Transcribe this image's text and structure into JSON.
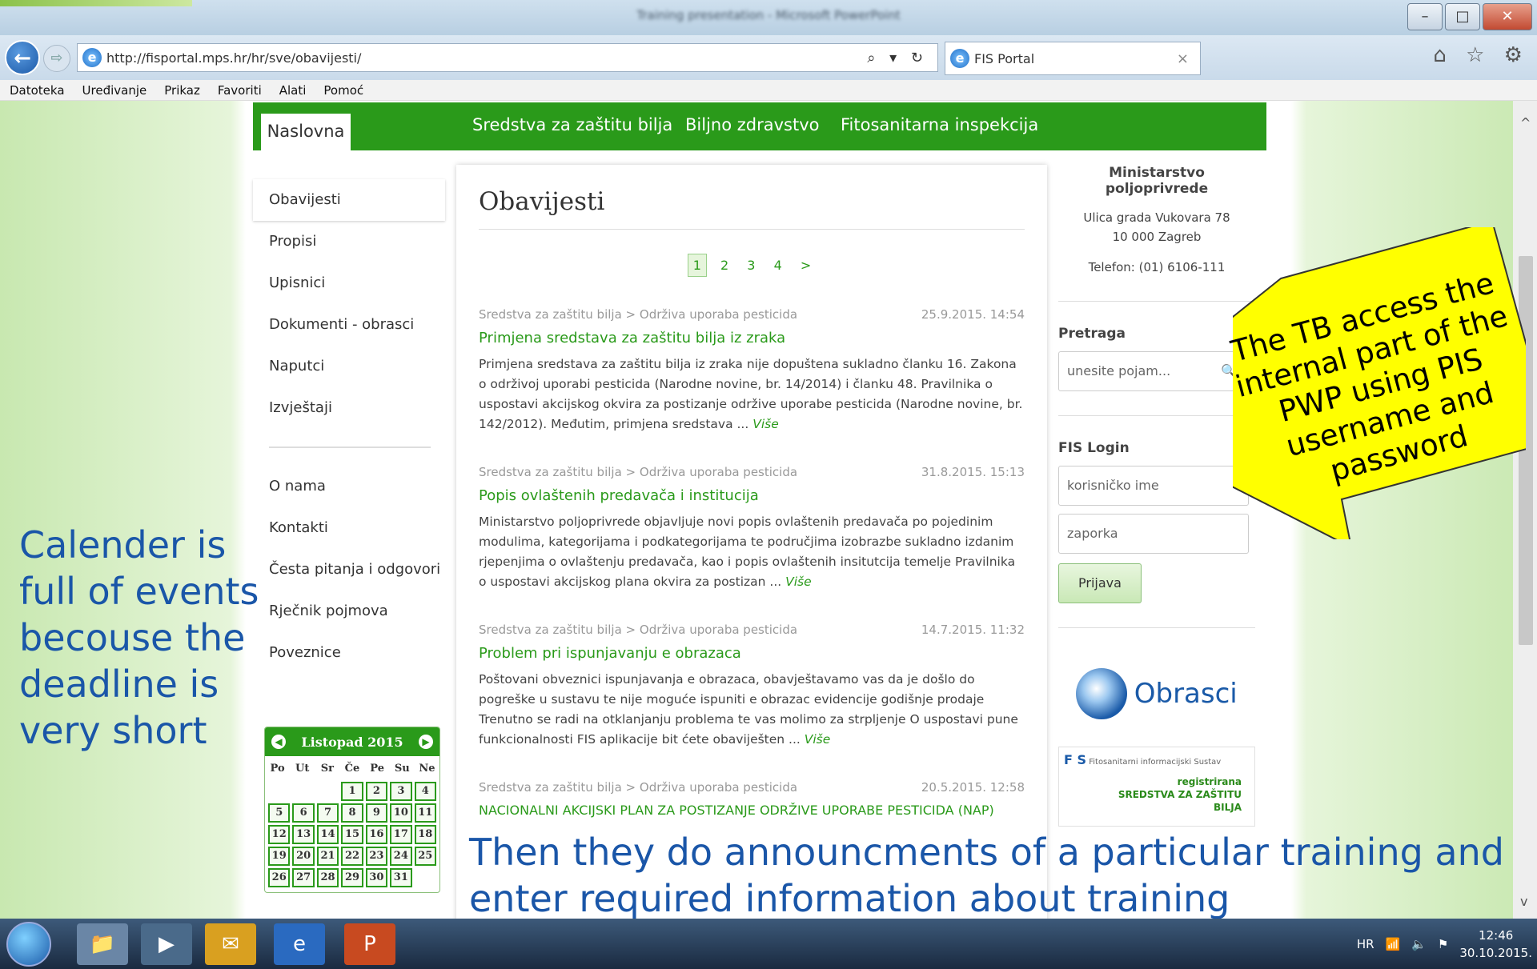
{
  "window": {
    "title": "Training presentation - Microsoft PowerPoint"
  },
  "browser": {
    "back_glyph": "←",
    "fwd_glyph": "⇨",
    "url": "http://fisportal.mps.hr/hr/sve/obavijesti/",
    "addr_controls": "⌕ ▾ ↻",
    "tab_title": "FIS Portal",
    "tab_close": "×",
    "toolbar_icons": "⌂ ☆ ⚙",
    "menu": [
      "Datoteka",
      "Uređivanje",
      "Prikaz",
      "Favoriti",
      "Alati",
      "Pomoć"
    ]
  },
  "site": {
    "home_tab": "Naslovna",
    "topnav": [
      "Sredstva za zaštitu bilja",
      "Biljno zdravstvo",
      "Fitosanitarna inspekcija"
    ],
    "sidebar": {
      "group1": [
        "Obavijesti",
        "Propisi",
        "Upisnici",
        "Dokumenti - obrasci",
        "Naputci",
        "Izvještaji"
      ],
      "group2": [
        "O nama",
        "Kontakti",
        "Česta pitanja i odgovori",
        "Rječnik pojmova",
        "Poveznice"
      ]
    },
    "calendar": {
      "title": "Listopad 2015",
      "weekdays": [
        "Po",
        "Ut",
        "Sr",
        "Če",
        "Pe",
        "Su",
        "Ne"
      ],
      "leading_blanks": 3,
      "days": 31
    },
    "main": {
      "heading": "Obavijesti",
      "pages": [
        "1",
        "2",
        "3",
        "4",
        ">"
      ],
      "articles": [
        {
          "category": "Sredstva za zaštitu bilja > Održiva uporaba pesticida",
          "date": "25.9.2015. 14:54",
          "title": "Primjena sredstava za zaštitu bilja iz zraka",
          "body": "Primjena sredstava za zaštitu bilja iz zraka nije dopuštena sukladno članku 16. Zakona o održivoj uporabi pesticida (Narodne novine, br. 14/2014) i članku 48. Pravilnika o uspostavi akcijskog okvira za postizanje održive uporabe pesticida (Narodne novine, br. 142/2012). Međutim, primjena sredstava ...",
          "more": "Više"
        },
        {
          "category": "Sredstva za zaštitu bilja > Održiva uporaba pesticida",
          "date": "31.8.2015. 15:13",
          "title": "Popis ovlaštenih predavača i institucija",
          "body": "Ministarstvo poljoprivrede objavljuje novi popis ovlaštenih predavača po pojedinim modulima, kategorijama i podkategorijama te područjima izobrazbe sukladno izdanim rjepenjima o ovlaštenju predavača, kao i popis ovlaštenih insitutcija temelje Pravilnika o uspostavi akcijskog plana okvira za postizan ...",
          "more": "Više"
        },
        {
          "category": "Sredstva za zaštitu bilja > Održiva uporaba pesticida",
          "date": "14.7.2015. 11:32",
          "title": "Problem pri ispunjavanju e obrazaca",
          "body": "Poštovani obveznici ispunjavanja e obrazaca, obavještavamo vas da je došlo do pogreške u sustavu te nije moguće ispuniti e obrazac evidencije godišnje prodaje Trenutno se radi na otklanjanju problema te vas molimo za strpljenje O uspostavi pune funkcionalnosti FIS aplikacije bit ćete obaviješten ...",
          "more": "Više"
        },
        {
          "category": "Sredstva za zaštitu bilja > Održiva uporaba pesticida",
          "date": "20.5.2015. 12:58",
          "title": "NACIONALNI AKCIJSKI PLAN ZA POSTIZANJE ODRŽIVE UPORABE PESTICIDA (NAP)",
          "body": "",
          "more": ""
        }
      ]
    },
    "right": {
      "org": "Ministarstvo poljoprivrede",
      "address": "Ulica grada Vukovara 78",
      "city": "10 000 Zagreb",
      "phone": "Telefon: (01) 6106-111",
      "search_heading": "Pretraga",
      "search_placeholder": "unesite pojam...",
      "login_heading": "FIS Login",
      "user_placeholder": "korisničko ime",
      "pass_placeholder": "zaporka",
      "login_button": "Prijava",
      "obrasci_label": "Obrasci",
      "fis_banner": {
        "letters": "F S",
        "subtitle": "Fitosanitarni informacijski Sustav",
        "line1": "registrirana",
        "line2": "SREDSTVA ZA ZAŠTITU",
        "line3": "BILJA"
      }
    }
  },
  "annotations": {
    "callout": "The TB access the internal part of the PWP using PIS username and password",
    "left_note": "Calender is full of events becouse the deadline is very short",
    "bottom_note": "Then they do announcments of a particular training and enter required information about training"
  },
  "taskbar": {
    "apps": [
      "explorer",
      "media",
      "outlook",
      "internet-explorer",
      "powerpoint"
    ],
    "lang": "HR",
    "time": "12:46",
    "date": "30.10.2015."
  },
  "colors": {
    "site_green": "#2a9a1a",
    "note_blue": "#1a56a8",
    "callout_yellow": "#ffff00"
  }
}
